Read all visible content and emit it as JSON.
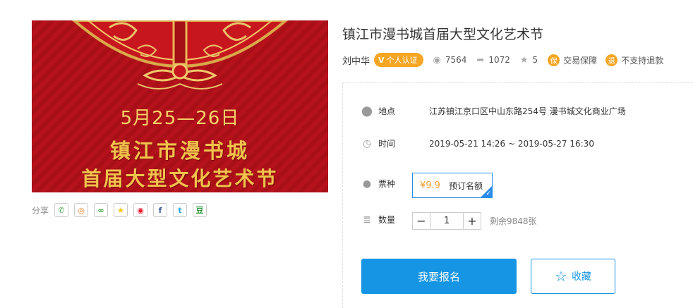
{
  "banner": {
    "date": "5月25—26日",
    "line1": "镇江市漫书城",
    "line2": "首届大型文化艺术节"
  },
  "share": {
    "label": "分享",
    "buttons": [
      {
        "name": "wechat-share-icon",
        "glyph": "✆",
        "color": "#3aa33a"
      },
      {
        "name": "moments-share-icon",
        "glyph": "◎",
        "color": "#e67e22"
      },
      {
        "name": "link-share-icon",
        "glyph": "∞",
        "color": "#3aa33a"
      },
      {
        "name": "qzone-share-icon",
        "glyph": "★",
        "color": "#f1c40f"
      },
      {
        "name": "weibo-share-icon",
        "glyph": "◉",
        "color": "#e6162d"
      },
      {
        "name": "facebook-share-icon",
        "glyph": "f",
        "color": "#3b5998"
      },
      {
        "name": "twitter-share-icon",
        "glyph": "t",
        "color": "#1da1f2"
      },
      {
        "name": "douban-share-icon",
        "glyph": "豆",
        "color": "#2e963d"
      }
    ]
  },
  "event": {
    "title": "镇江市漫书城首届大型文化艺术节",
    "organizer": "刘中华",
    "verified_label": "个人认证",
    "views": "7564",
    "shares": "1072",
    "stars": "5",
    "guarantee": "交易保障",
    "guarantee_badge": "保",
    "refund": "不支持退款",
    "refund_badge": "退"
  },
  "details": {
    "location_label": "地点",
    "location": "江苏镇江京口区中山东路254号 漫书城文化商业广场",
    "time_label": "时间",
    "time": "2019-05-21 14:26 ~ 2019-05-27 16:30",
    "ticket_label": "票种",
    "ticket_price": "¥9.9",
    "ticket_name": "预订名额",
    "quantity_label": "数量",
    "quantity_value": "1",
    "minus": "−",
    "plus": "+",
    "remaining": "剩余9848张"
  },
  "actions": {
    "apply_label": "我要报名",
    "favorite_label": "收藏"
  },
  "colors": {
    "accent": "#1595e3",
    "ticket_border": "#2b8ce8",
    "verified": "#f5a623",
    "banner_red": "#b5121b",
    "gold": "#f2c24c"
  }
}
